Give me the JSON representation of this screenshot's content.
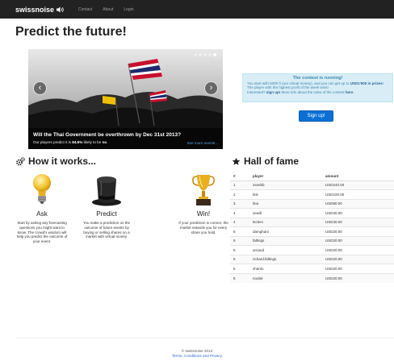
{
  "navbar": {
    "brand": "swissnoise",
    "links": [
      "Contact",
      "About",
      "Login"
    ]
  },
  "page_title": "Predict the future!",
  "carousel": {
    "title": "Will the Thai Government be overthrown by Dec 31st 2013?",
    "sub_prefix": "Our players predict it is ",
    "sub_pct": "84.6%",
    "sub_middle": " likely to be ",
    "sub_outcome": "no",
    "sub_suffix": ".",
    "more_link": "See more events...",
    "prev_arrow": "‹",
    "next_arrow": "›",
    "slide_count": 5,
    "active_slide": 5
  },
  "contest": {
    "title": "The contest is running!",
    "line1_a": "You start with 5000 ",
    "line1_b": " (our virtual money), and you can get up to ",
    "prize": "USD1'500 in prizes",
    "line1_c": "! The player with the highest profit of the week wins!",
    "line2_a": "Interested? ",
    "signup_link": "sign up!",
    "line2_b": " More info about the rules of the contest ",
    "here_link": "here",
    "line2_c": ".",
    "currency_symbol": "ñ"
  },
  "signup_button": "Sign up!",
  "how": {
    "title": "How it works...",
    "columns": [
      {
        "heading": "Ask",
        "text": "Start by asking any forecasting questions you might want to know. The crowd's wisdom will help you predict the outcome of your event."
      },
      {
        "heading": "Predict",
        "text": "You make a prediction on the outcome of future events by buying or selling shares on a market with virtual money."
      },
      {
        "heading": "Win!",
        "text": "If your prediction is correct, the market rewards you for every share you hold."
      }
    ]
  },
  "hall": {
    "title": "Hall of fame",
    "headers": [
      "#",
      "player",
      "amount"
    ],
    "rows": [
      [
        "1",
        "sseebb",
        "USD240.00"
      ],
      [
        "2",
        "link",
        "USD100.00"
      ],
      [
        "3",
        "lina",
        "USD80.00"
      ],
      [
        "4",
        "xewill",
        "USD40.00"
      ],
      [
        "4",
        "leclem",
        "USD40.00"
      ],
      [
        "5",
        "damghani",
        "USD20.00"
      ],
      [
        "5",
        "faltings",
        "USD20.00"
      ],
      [
        "5",
        "arnaud",
        "USD20.00"
      ],
      [
        "5",
        "richard.faltings",
        "USD20.00"
      ],
      [
        "5",
        "xhanto",
        "USD20.00"
      ],
      [
        "5",
        "noobé",
        "USD20.00"
      ]
    ]
  },
  "footer": {
    "copyright": "© swissnoise 2013",
    "terms": "Terms, Conditions and Privacy"
  },
  "colors": {
    "navbar_bg": "#222222",
    "info_bg": "#d9edf7",
    "info_text": "#3a87ad",
    "primary_button": "#0b6fd6",
    "link": "#2a6ad0"
  },
  "icons": [
    "speaker-icon",
    "gears-icon",
    "star-icon",
    "lightbulb-icon",
    "top-hat-icon",
    "trophy-icon",
    "chevron-left-icon",
    "chevron-right-icon"
  ]
}
